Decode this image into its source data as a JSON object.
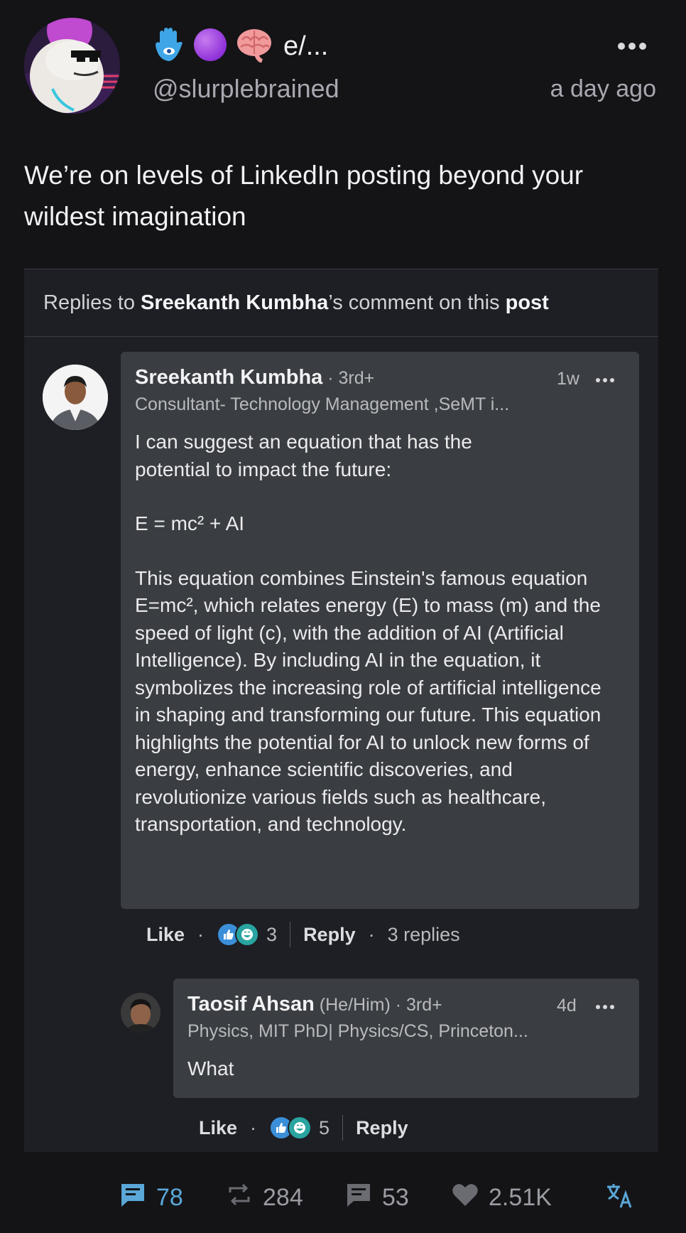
{
  "post": {
    "display_name": "e/...",
    "handle": "@slurplebrained",
    "time_ago": "a day ago",
    "badges": [
      "hamsa-icon",
      "purple-circle-icon",
      "brain-icon"
    ],
    "text": "We’re on levels of LinkedIn posting beyond your wildest imagination"
  },
  "embed": {
    "header_prefix": "Replies to ",
    "header_name": "Sreekanth Kumbha",
    "header_mid": "’s comment on this ",
    "header_post": "post",
    "comment": {
      "name": "Sreekanth Kumbha",
      "degree": " · 3rd+",
      "subtitle": "Consultant- Technology Management ,SeMT i...",
      "time": "1w",
      "paragraphs": [
        "I can suggest an equation that has the potential to impact the future:",
        "E = mc² + AI",
        "This equation combines Einstein's famous equation E=mc², which relates energy (E) to mass (m) and the speed of light (c), with the addition of AI (Artificial Intelligence). By including AI in the equation, it symbolizes the increasing role of artificial intelligence in shaping and transforming our future. This equation highlights the potential for AI to unlock new forms of energy, enhance scientific discoveries, and revolutionize various fields such as healthcare, transportation, and technology."
      ],
      "like_label": "Like",
      "reaction_count": "3",
      "reply_label": "Reply",
      "replies_label": "3 replies"
    },
    "reply": {
      "name": "Taosif Ahsan",
      "pronouns": " (He/Him)",
      "degree": " · 3rd+",
      "subtitle": "Physics, MIT PhD| Physics/CS, Princeton...",
      "time": "4d",
      "text": "What",
      "like_label": "Like",
      "reaction_count": "5",
      "reply_label": "Reply"
    }
  },
  "footer": {
    "comments": "78",
    "reposts": "284",
    "quotes": "53",
    "likes": "2.51K"
  },
  "colors": {
    "background": "#141417",
    "embed_bg": "#1d1f24",
    "bubble": "#3a3d41",
    "accent": "#5aa7d8",
    "like_blue": "#3b8fd9",
    "funny_teal": "#29a4a0"
  }
}
